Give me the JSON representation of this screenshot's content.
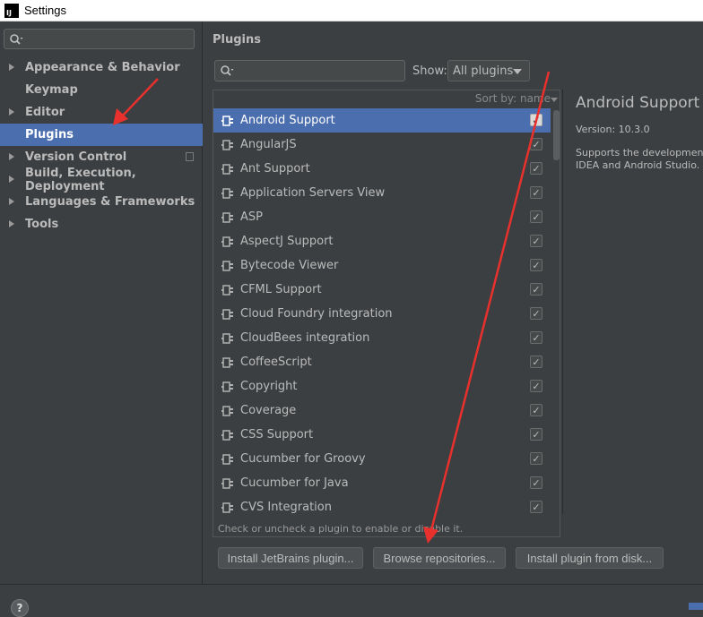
{
  "window": {
    "title": "Settings",
    "app_icon_text": "IJ"
  },
  "sidebar": {
    "items": [
      {
        "label": "Appearance & Behavior",
        "expandable": true
      },
      {
        "label": "Keymap",
        "expandable": false
      },
      {
        "label": "Editor",
        "expandable": true
      },
      {
        "label": "Plugins",
        "expandable": false,
        "selected": true
      },
      {
        "label": "Version Control",
        "expandable": true
      },
      {
        "label": "Build, Execution, Deployment",
        "expandable": true
      },
      {
        "label": "Languages & Frameworks",
        "expandable": true
      },
      {
        "label": "Tools",
        "expandable": true
      }
    ]
  },
  "main": {
    "title": "Plugins",
    "show_label": "Show:",
    "show_value": "All plugins",
    "sort_label": "Sort by: name",
    "plugins": [
      {
        "name": "Android Support",
        "checked": true,
        "selected": true
      },
      {
        "name": "AngularJS",
        "checked": true
      },
      {
        "name": "Ant Support",
        "checked": true
      },
      {
        "name": "Application Servers View",
        "checked": true
      },
      {
        "name": "ASP",
        "checked": true
      },
      {
        "name": "AspectJ Support",
        "checked": true
      },
      {
        "name": "Bytecode Viewer",
        "checked": true
      },
      {
        "name": "CFML Support",
        "checked": true
      },
      {
        "name": "Cloud Foundry integration",
        "checked": true
      },
      {
        "name": "CloudBees integration",
        "checked": true
      },
      {
        "name": "CoffeeScript",
        "checked": true
      },
      {
        "name": "Copyright",
        "checked": true
      },
      {
        "name": "Coverage",
        "checked": true
      },
      {
        "name": "CSS Support",
        "checked": true
      },
      {
        "name": "Cucumber for Groovy",
        "checked": true
      },
      {
        "name": "Cucumber for Java",
        "checked": true
      },
      {
        "name": "CVS Integration",
        "checked": true
      }
    ],
    "details": {
      "title": "Android Support",
      "version": "Version: 10.3.0",
      "desc_line1": "Supports the development",
      "desc_line2": "IDEA and Android Studio."
    },
    "hint": "Check or uncheck a plugin to enable or disable it.",
    "buttons": {
      "install_jetbrains": "Install JetBrains plugin...",
      "browse_repos": "Browse repositories...",
      "install_disk": "Install plugin from disk..."
    }
  },
  "help_label": "?",
  "colors": {
    "selection": "#4b6eaf",
    "annotation_arrow": "#e8302d"
  }
}
